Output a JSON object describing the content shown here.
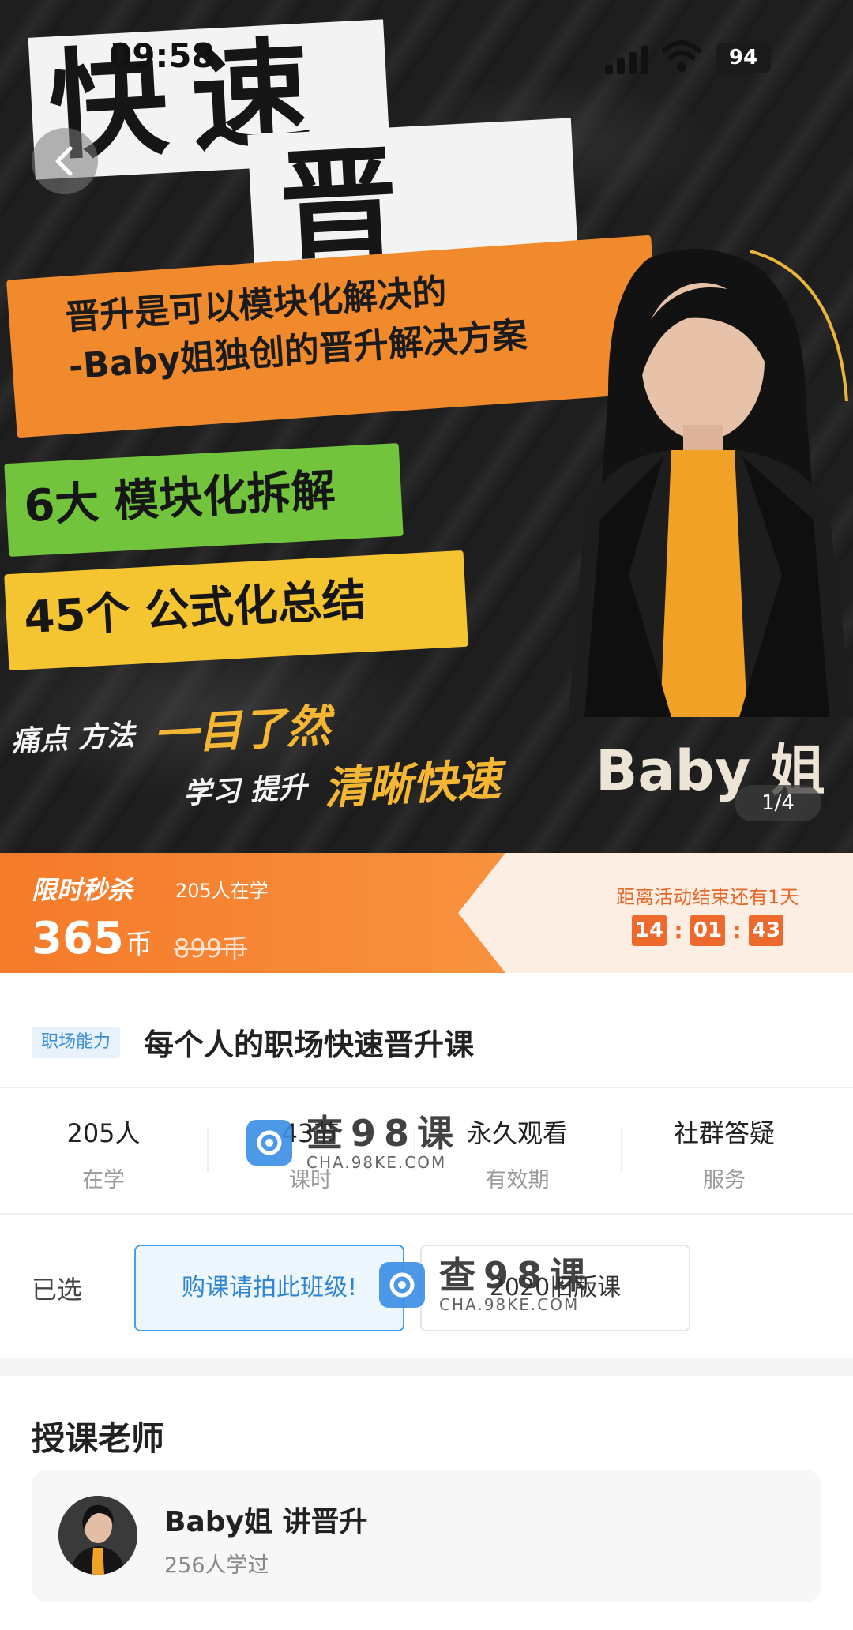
{
  "status_bar": {
    "time": "09:58",
    "battery": "94"
  },
  "banner": {
    "title_line1": "快速",
    "title_line2": "晋升",
    "orange_line1": "晋升是可以模块化解决的",
    "orange_line2": "-Baby姐独创的晋升解决方案",
    "green_text": "6大 模块化拆解",
    "yellow_text": "45个 公式化总结",
    "tag1_plain": "痛点 方法",
    "tag1_accent": "一目了然",
    "tag2_plain": "学习 提升",
    "tag2_accent": "清晰快速",
    "brand": "Baby 姐",
    "page_indicator": "1/4"
  },
  "sale": {
    "label": "限时秒杀",
    "learners": "205人在学",
    "price": "365",
    "price_unit": "币",
    "original_price": "899币",
    "countdown_label": "距离活动结束还有1天",
    "countdown": {
      "hours": "14",
      "minutes": "01",
      "seconds": "43"
    }
  },
  "course": {
    "category": "职场能力",
    "title": "每个人的职场快速晋升课"
  },
  "stats": [
    {
      "value": "205人",
      "label": "在学"
    },
    {
      "value": "43节",
      "label": "课时"
    },
    {
      "value": "永久观看",
      "label": "有效期"
    },
    {
      "value": "社群答疑",
      "label": "服务"
    }
  ],
  "selection": {
    "label": "已选",
    "options": [
      "购课请拍此班级!",
      "2020旧版课"
    ]
  },
  "teacher": {
    "section_title": "授课老师",
    "name": "Baby姐 讲晋升",
    "learned": "256人学过"
  },
  "watermark": {
    "text": "查98课",
    "url": "CHA.98KE.COM"
  },
  "colors": {
    "accent_orange": "#f57a2a",
    "accent_blue": "#3d8fd6",
    "sale_bg": "#fdeee3"
  }
}
